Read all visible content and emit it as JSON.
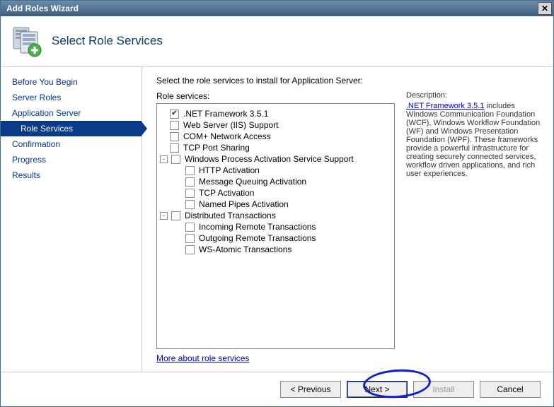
{
  "window": {
    "title": "Add Roles Wizard"
  },
  "header": {
    "title": "Select Role Services"
  },
  "sidebar": {
    "items": [
      {
        "label": "Before You Begin",
        "sel": false,
        "sub": false
      },
      {
        "label": "Server Roles",
        "sel": false,
        "sub": false
      },
      {
        "label": "Application Server",
        "sel": false,
        "sub": false
      },
      {
        "label": "Role Services",
        "sel": true,
        "sub": true
      },
      {
        "label": "Confirmation",
        "sel": false,
        "sub": false
      },
      {
        "label": "Progress",
        "sel": false,
        "sub": false
      },
      {
        "label": "Results",
        "sel": false,
        "sub": false
      }
    ]
  },
  "main": {
    "instruction": "Select the role services to install for Application Server:",
    "left_label": "Role services:",
    "tree": [
      {
        "depth": 0,
        "checked": true,
        "label": ".NET Framework 3.5.1"
      },
      {
        "depth": 0,
        "checked": false,
        "label": "Web Server (IIS) Support"
      },
      {
        "depth": 0,
        "checked": false,
        "label": "COM+ Network Access"
      },
      {
        "depth": 0,
        "checked": false,
        "label": "TCP Port Sharing"
      },
      {
        "depth": 0,
        "checked": false,
        "label": "Windows Process Activation Service Support",
        "expander": "-"
      },
      {
        "depth": 1,
        "checked": false,
        "label": "HTTP Activation"
      },
      {
        "depth": 1,
        "checked": false,
        "label": "Message Queuing Activation"
      },
      {
        "depth": 1,
        "checked": false,
        "label": "TCP Activation"
      },
      {
        "depth": 1,
        "checked": false,
        "label": "Named Pipes Activation"
      },
      {
        "depth": 0,
        "checked": false,
        "label": "Distributed Transactions",
        "expander": "-"
      },
      {
        "depth": 1,
        "checked": false,
        "label": "Incoming Remote Transactions"
      },
      {
        "depth": 1,
        "checked": false,
        "label": "Outgoing Remote Transactions"
      },
      {
        "depth": 1,
        "checked": false,
        "label": "WS-Atomic Transactions"
      }
    ],
    "right_label": "Description:",
    "desc_link": ".NET Framework 3.5.1",
    "desc_text": " includes Windows Communication Foundation (WCF), Windows Workflow Foundation (WF) and Windows Presentation Foundation (WPF). These frameworks provide a powerful infrastructure for creating securely connected services, workflow driven applications, and rich user experiences.",
    "more_link": "More about role services"
  },
  "footer": {
    "previous": "< Previous",
    "next": "Next >",
    "install": "Install",
    "cancel": "Cancel"
  }
}
